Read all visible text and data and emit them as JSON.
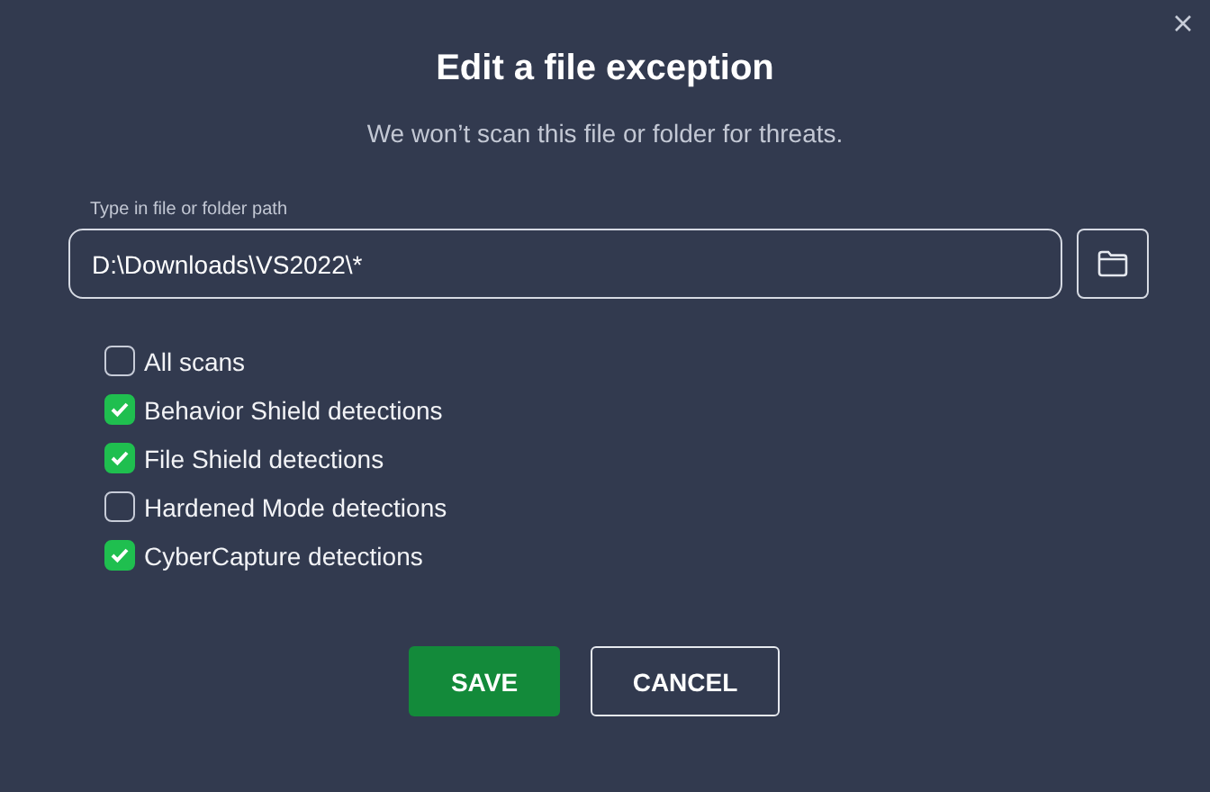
{
  "dialog": {
    "title": "Edit a file exception",
    "subtitle": "We won’t scan this file or folder for threats."
  },
  "path_field": {
    "label": "Type in file or folder path",
    "value": "D:\\Downloads\\VS2022\\*"
  },
  "options": [
    {
      "label": "All scans",
      "checked": false
    },
    {
      "label": "Behavior Shield detections",
      "checked": true
    },
    {
      "label": "File Shield detections",
      "checked": true
    },
    {
      "label": "Hardened Mode detections",
      "checked": false
    },
    {
      "label": "CyberCapture detections",
      "checked": true
    }
  ],
  "buttons": [
    {
      "label": "SAVE",
      "kind": "primary"
    },
    {
      "label": "CANCEL",
      "kind": "secondary"
    }
  ]
}
